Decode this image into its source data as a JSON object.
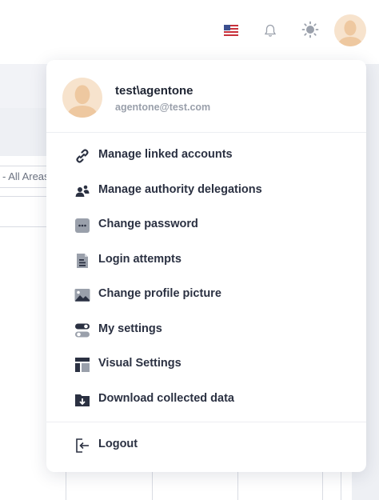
{
  "header": {
    "language_icon": "us-flag-icon",
    "notifications_icon": "bell-icon",
    "theme_icon": "sun-icon"
  },
  "background": {
    "filter_text": "- All Areas"
  },
  "user": {
    "name": "test\\agentone",
    "email": "agentone@test.com"
  },
  "menu": {
    "items": [
      {
        "label": "Manage linked accounts",
        "icon": "link-icon"
      },
      {
        "label": "Manage authority delegations",
        "icon": "people-icon"
      },
      {
        "label": "Change password",
        "icon": "password-icon"
      },
      {
        "label": "Login attempts",
        "icon": "document-icon"
      },
      {
        "label": "Change profile picture",
        "icon": "image-icon"
      },
      {
        "label": "My settings",
        "icon": "toggles-icon"
      },
      {
        "label": "Visual Settings",
        "icon": "layout-icon"
      },
      {
        "label": "Download collected data",
        "icon": "folder-download-icon"
      }
    ],
    "logout_label": "Logout"
  },
  "colors": {
    "text": "#2b3142",
    "muted": "#9aa0ab",
    "icon": "#2b3142",
    "avatar_bg": "#f7e3cd",
    "avatar_skin": "#eec8a0"
  }
}
